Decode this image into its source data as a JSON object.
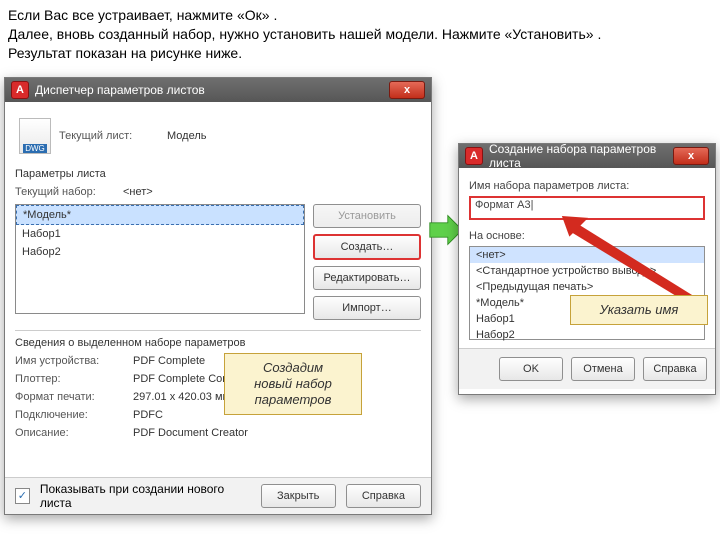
{
  "doc": {
    "p1": "Если Вас все устраивает, нажмите «Ок» .",
    "p2": "Далее, вновь созданный набор, нужно установить нашей модели. Нажмите «Установить» .",
    "p3": "Результат показан на рисунке ниже."
  },
  "win1": {
    "title": "Диспетчер параметров листов",
    "logo": "A",
    "close": "x",
    "dwg": "DWG",
    "current_sheet_label": "Текущий лист:",
    "current_sheet_value": "Модель",
    "params_section": "Параметры листа",
    "current_set_label": "Текущий набор:",
    "current_set_value": "<нет>",
    "list": {
      "i0": "*Модель*",
      "i1": "Набор1",
      "i2": "Набор2"
    },
    "buttons": {
      "install": "Установить",
      "create": "Создать…",
      "edit": "Редактировать…",
      "import": "Импорт…"
    },
    "info_section": "Сведения о выделенном наборе параметров",
    "info": {
      "device_label": "Имя устройства:",
      "device_value": "PDF Complete",
      "plotter_label": "Плоттер:",
      "plotter_value": "PDF Complete Converter",
      "format_label": "Формат печати:",
      "format_value": "297.01 x 420.03 мм (Книжная)",
      "conn_label": "Подключение:",
      "conn_value": "PDFC",
      "desc_label": "Описание:",
      "desc_value": "PDF Document Creator"
    },
    "footer": {
      "checkbox_checked": "✓",
      "checkbox_label": "Показывать при создании нового листа",
      "close_btn": "Закрыть",
      "help_btn": "Справка"
    }
  },
  "win2": {
    "title": "Создание набора параметров листа",
    "logo": "A",
    "close": "x",
    "name_label": "Имя набора параметров листа:",
    "name_value": "Формат А3|",
    "base_label": "На основе:",
    "options": {
      "o0": "<нет>",
      "o1": "<Стандартное устройство вывода>",
      "o2": "<Предыдущая печать>",
      "o3": "*Модель*",
      "o4": "Набор1",
      "o5": "Набор2"
    },
    "ok": "OK",
    "cancel": "Отмена",
    "help": "Справка"
  },
  "callout1": {
    "l1": "Создадим",
    "l2": "новый набор",
    "l3": "параметров"
  },
  "callout2": {
    "l1": "Указать имя"
  }
}
